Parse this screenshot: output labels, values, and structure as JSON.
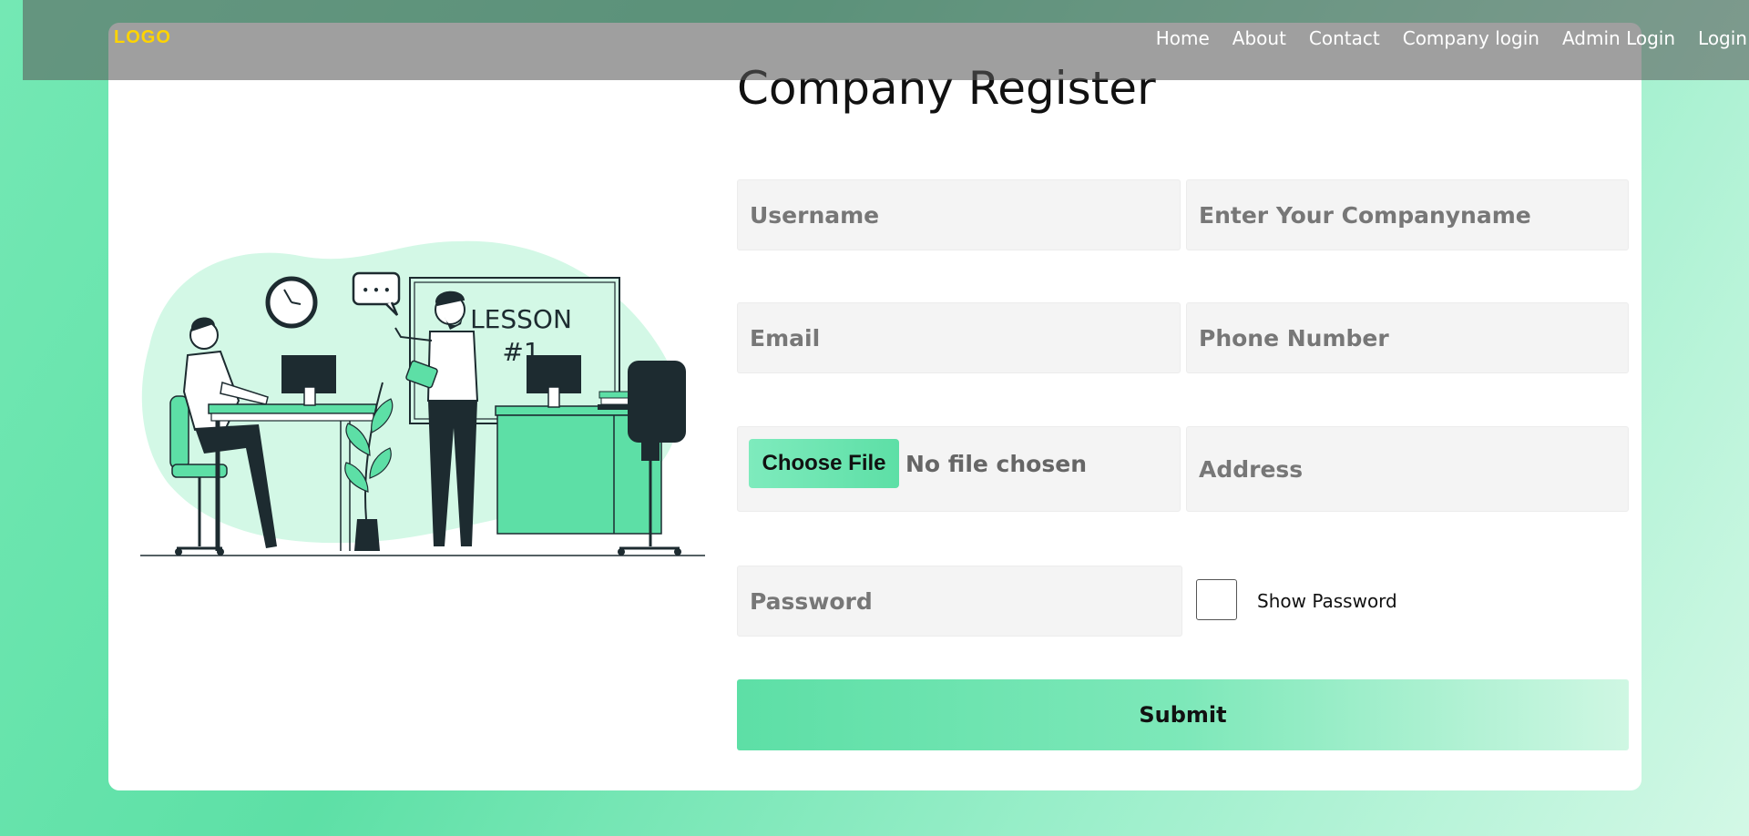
{
  "nav": {
    "logo": "LOGO",
    "links": [
      "Home",
      "About",
      "Contact",
      "Company login",
      "Admin Login",
      "Login"
    ]
  },
  "page": {
    "title": "Company Register"
  },
  "form": {
    "username_placeholder": "Username",
    "companyname_placeholder": "Enter Your Companyname",
    "email_placeholder": "Email",
    "phone_placeholder": "Phone Number",
    "file_button": "Choose File",
    "file_status": "No file chosen",
    "address_placeholder": "Address",
    "password_placeholder": "Password",
    "show_password_label": "Show Password",
    "show_password_checked": false,
    "submit_label": "Submit"
  },
  "illustration": {
    "board_text_line1": "LESSON",
    "board_text_line2": "#1",
    "bubble_text": "• • •"
  },
  "colors": {
    "accent": "#5ddfa6",
    "logo": "#ffd400",
    "dark": "#1d2b30"
  }
}
